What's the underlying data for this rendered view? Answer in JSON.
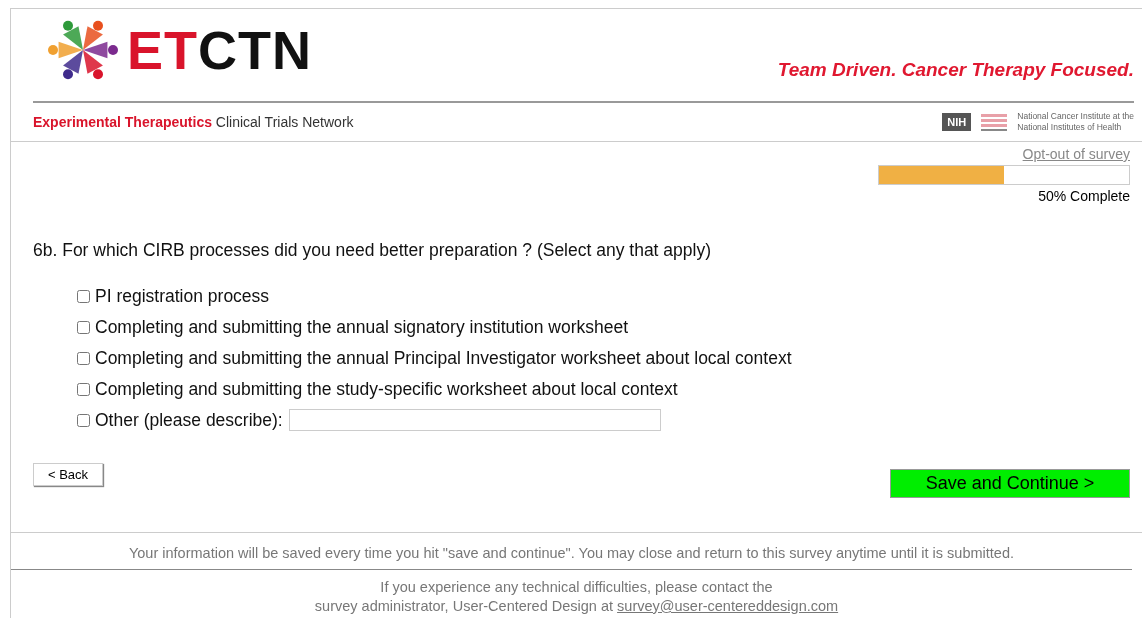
{
  "header": {
    "logo_text_red": "ET",
    "logo_text_black": "CTN",
    "tagline": "Team Driven. Cancer Therapy Focused.",
    "network_red": "Experimental Therapeutics",
    "network_rest": "Clinical Trials Network",
    "nih_badge": "NIH",
    "institute_lines": [
      "National Cancer Institute at the",
      "National Institutes of Health"
    ]
  },
  "survey": {
    "opt_out": "Opt-out of survey",
    "progress": {
      "level": 0.5,
      "reading": "50% Complete"
    },
    "question": "6b. For which CIRB processes did you need better preparation ? (Select any that apply)",
    "options": [
      {
        "kind": "checkbox",
        "label": "PI registration process",
        "checked": false
      },
      {
        "kind": "checkbox",
        "label": "Completing and submitting the annual signatory institution worksheet",
        "checked": false
      },
      {
        "kind": "checkbox",
        "label": "Completing and submitting the annual Principal Investigator worksheet about local context",
        "checked": false
      },
      {
        "kind": "checkbox",
        "label": "Completing and submitting the study-specific worksheet about local context",
        "checked": false
      },
      {
        "kind": "other",
        "label": "Other (please describe):",
        "checked": false
      }
    ],
    "back": "< Back",
    "continue": "Save and Continue >"
  },
  "footer": {
    "notice": "Your information will be saved every time you hit \"save and continue\". You may close and return to this survey anytime until it is submitted.",
    "contact_line1": "If you experience any technical difficulties, please contact the",
    "contact_line2": "survey administrator, User-Centered Design at",
    "email": "survey@user-centereddesign.com"
  }
}
